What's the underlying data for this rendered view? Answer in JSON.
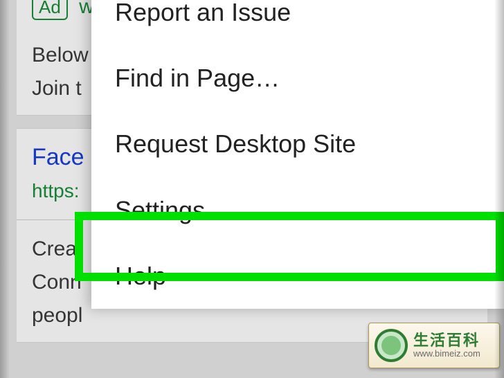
{
  "background": {
    "ad_badge": "Ad",
    "ad_partial": "w",
    "card1_line1": "Below",
    "card1_line2": "Join t",
    "card2_title": "Face",
    "card2_url": "https:",
    "card2_body1": "Creat",
    "card2_body2": "Conn",
    "card2_body3": "peopl"
  },
  "menu": {
    "items": [
      {
        "label": "Report an Issue"
      },
      {
        "label": "Find in Page…"
      },
      {
        "label": "Request Desktop Site"
      },
      {
        "label": "Settings",
        "highlighted": true
      },
      {
        "label": "Help"
      }
    ]
  },
  "watermark": {
    "title": "生活百科",
    "url": "www.bimeiz.com"
  }
}
